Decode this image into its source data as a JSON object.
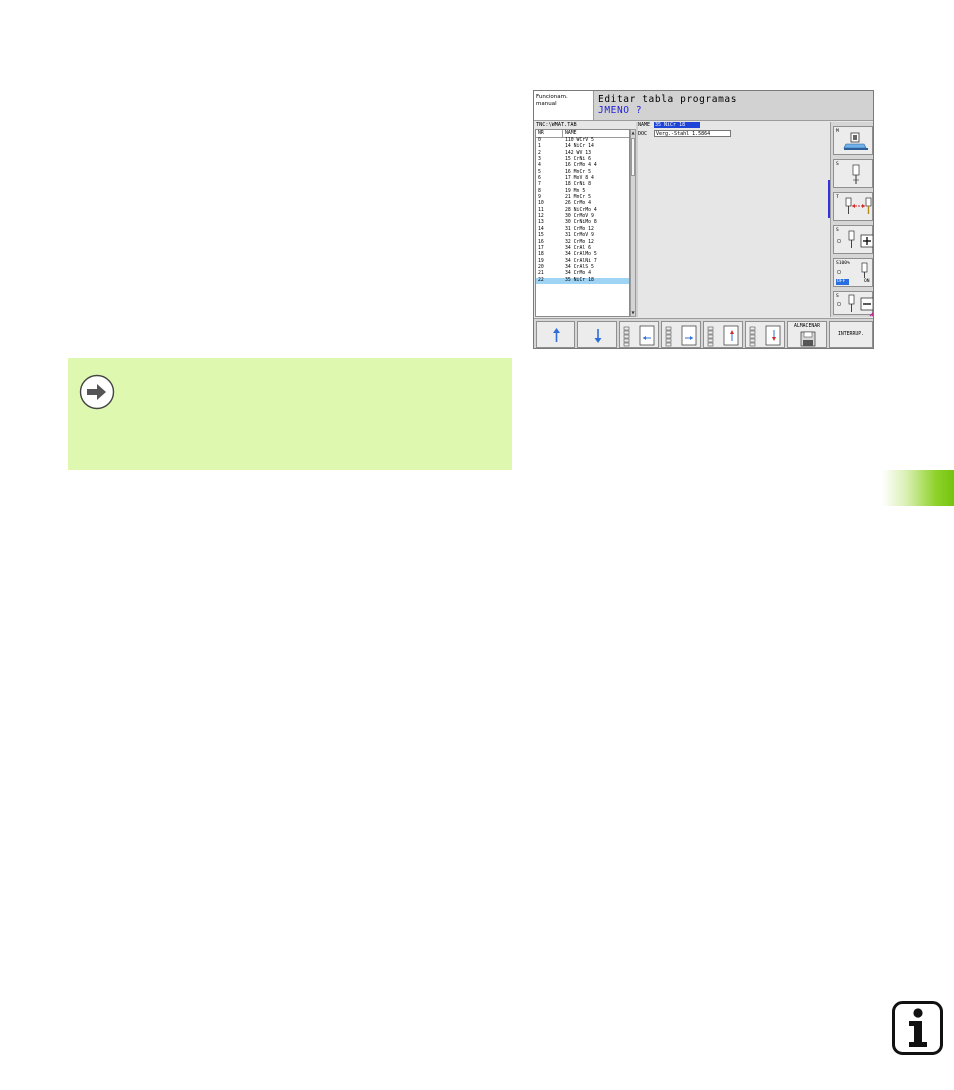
{
  "screen": {
    "mode": [
      "Funcionam.",
      "manual"
    ],
    "title": "Editar tabla programas",
    "prompt": "JMENO ?",
    "path": "TNC:\\WMAT.TAB",
    "table": {
      "col_nr": "NR",
      "col_name": "NAME",
      "rows": [
        {
          "nr": "0",
          "name": "110 WCrV 5"
        },
        {
          "nr": "1",
          "name": "14 NiCr 14"
        },
        {
          "nr": "2",
          "name": "142 WV 13"
        },
        {
          "nr": "3",
          "name": "15 CrNi 6"
        },
        {
          "nr": "4",
          "name": "16 CrMo 4 4"
        },
        {
          "nr": "5",
          "name": "16 MnCr 5"
        },
        {
          "nr": "6",
          "name": "17 MoV 8 4"
        },
        {
          "nr": "7",
          "name": "18 CrNi 8"
        },
        {
          "nr": "8",
          "name": "19 Mn 5"
        },
        {
          "nr": "9",
          "name": "21 MnCr 5"
        },
        {
          "nr": "10",
          "name": "26 CrMo 4"
        },
        {
          "nr": "11",
          "name": "28 NiCrMo 4"
        },
        {
          "nr": "12",
          "name": "30 CrMoV 9"
        },
        {
          "nr": "13",
          "name": "30 CrNiMo 8"
        },
        {
          "nr": "14",
          "name": "31 CrMo 12"
        },
        {
          "nr": "15",
          "name": "31 CrMoV 9"
        },
        {
          "nr": "16",
          "name": "32 CrMo 12"
        },
        {
          "nr": "17",
          "name": "34 CrAl 6"
        },
        {
          "nr": "18",
          "name": "34 CrAlMo 5"
        },
        {
          "nr": "19",
          "name": "34 CrAlNi 7"
        },
        {
          "nr": "20",
          "name": "34 CrAlS 5"
        },
        {
          "nr": "21",
          "name": "34 CrMo 4"
        },
        {
          "nr": "22",
          "name": "35 NiCr 18"
        }
      ],
      "selected_index": 22
    },
    "form": {
      "name_label": "NAME",
      "name_value": "35 NiCr 18",
      "doc_label": "DOC",
      "doc_value": "Verg.-Stahl 1.5864"
    },
    "side_keys": [
      {
        "label": "M",
        "icon": "coolant-icon"
      },
      {
        "label": "S",
        "icon": "spindle-tool-icon"
      },
      {
        "label": "T",
        "icon": "tool-change-icon"
      },
      {
        "label": "S",
        "icon": "spindle-plus-icon"
      },
      {
        "label": "S100%",
        "off": "OFF",
        "on": "ON",
        "icon": "spindle-override-icon"
      },
      {
        "label": "S",
        "icon": "spindle-minus-icon"
      }
    ],
    "bottom_keys": {
      "up": "up-arrow-icon",
      "down": "down-arrow-icon",
      "save": "ALMACENAR",
      "end": "INTERRUP."
    },
    "accent": "#2222d8"
  },
  "note": {
    "icon": "arrow-right-circle-icon",
    "bg": "#dff8b0"
  },
  "page": {
    "info_icon": "info-icon",
    "chapter_tab_color": "#73c40f"
  }
}
